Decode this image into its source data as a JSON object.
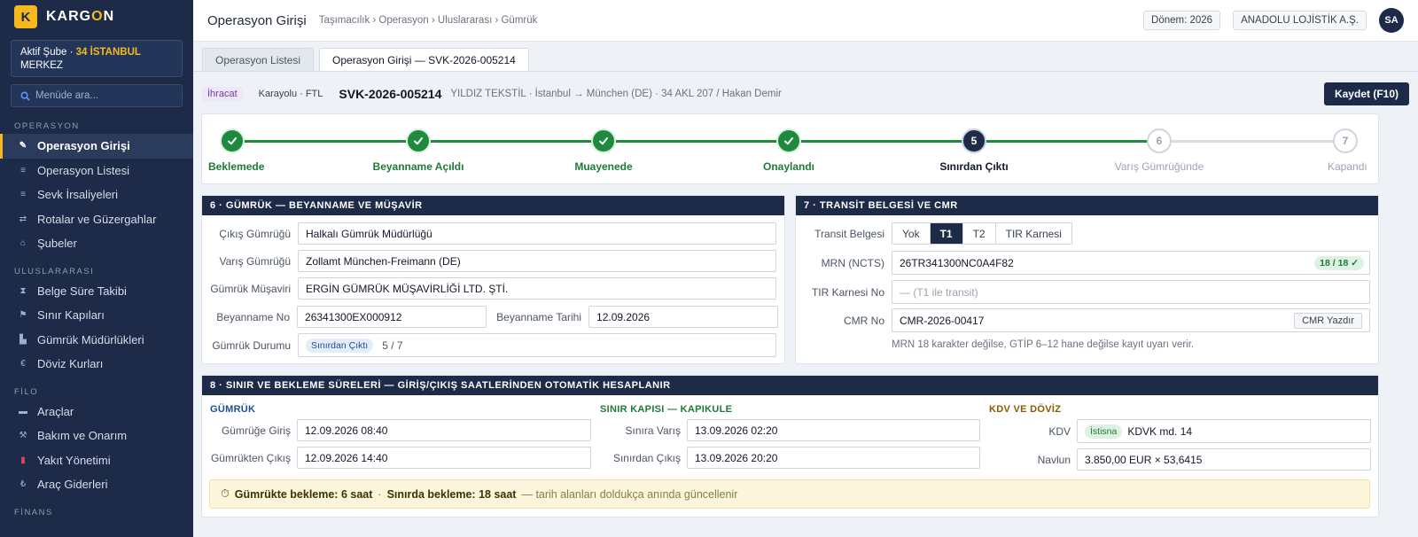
{
  "brand": {
    "logo": "K",
    "name_a": "KARG",
    "name_b": "O",
    "name_c": "N"
  },
  "branch": {
    "prefix": "Aktif Şube · ",
    "code": "34 İSTANBUL",
    "suffix": "MERKEZ"
  },
  "search": {
    "placeholder": "Menüde ara..."
  },
  "nav": {
    "sec_operasyon": "OPERASYON",
    "operasyon_girisi": "Operasyon Girişi",
    "operasyon_listesi": "Operasyon Listesi",
    "sevk": "Sevk İrsaliyeleri",
    "rotalar": "Rotalar ve Güzergahlar",
    "subeler": "Şubeler",
    "sec_uluslararasi": "ULUSLARARASI",
    "belge": "Belge Süre Takibi",
    "sinir": "Sınır Kapıları",
    "gumruk_mud": "Gümrük Müdürlükleri",
    "doviz": "Döviz Kurları",
    "sec_filo": "FİLO",
    "araclar": "Araçlar",
    "bakim": "Bakım ve Onarım",
    "yakit": "Yakıt Yönetimi",
    "arac_gider": "Araç Giderleri",
    "sec_finans": "FİNANS"
  },
  "header": {
    "title": "Operasyon Girişi",
    "breadcrumb": "Taşımacılık › Operasyon › Uluslararası › Gümrük",
    "period": "Dönem: 2026",
    "company": "ANADOLU LOJİSTİK A.Ş.",
    "avatar": "SA"
  },
  "tabs": {
    "list": "Operasyon Listesi",
    "entry": "Operasyon Girişi — SVK-2026-005214"
  },
  "op": {
    "type": "İhracat",
    "mode": "Karayolu · FTL",
    "number": "SVK-2026-005214",
    "desc": "YILDIZ TEKSTİL · İstanbul → München (DE) · 34 AKL 207 / Hakan Demir",
    "save": "Kaydet (F10)"
  },
  "steps": [
    {
      "num": "1",
      "label": "Beklemede",
      "state": "done"
    },
    {
      "num": "2",
      "label": "Beyanname Açıldı",
      "state": "done"
    },
    {
      "num": "3",
      "label": "Muayenede",
      "state": "done"
    },
    {
      "num": "4",
      "label": "Onaylandı",
      "state": "done"
    },
    {
      "num": "5",
      "label": "Sınırdan Çıktı",
      "state": "current"
    },
    {
      "num": "6",
      "label": "Varış Gümrüğünde",
      "state": "todo"
    },
    {
      "num": "7",
      "label": "Kapandı",
      "state": "todo"
    }
  ],
  "customs": {
    "title": "6 · GÜMRÜK  —  BEYANNAME VE MÜŞAVİR",
    "exit_label": "Çıkış Gümrüğü",
    "exit_value": "Halkalı Gümrük Müdürlüğü",
    "arr_label": "Varış Gümrüğü",
    "arr_value": "Zollamt München-Freimann (DE)",
    "broker_label": "Gümrük Müşaviri",
    "broker_value": "ERGİN GÜMRÜK MÜŞAVİRLİĞİ LTD. ŞTİ.",
    "decl_no_label": "Beyanname No",
    "decl_no_value": "26341300EX000912",
    "decl_date_label": "Beyanname Tarihi",
    "decl_date_value": "12.09.2026",
    "status_label": "Gümrük Durumu",
    "status_chip": "Sınırdan Çıktı",
    "status_step": "5 / 7"
  },
  "transit": {
    "title": "7 · TRANSİT BELGESİ VE CMR",
    "doc_label": "Transit Belgesi",
    "options": [
      "Yok",
      "T1",
      "T2",
      "TIR Karnesi"
    ],
    "selected": "T1",
    "mrn_label": "MRN (NCTS)",
    "mrn_value": "26TR341300NC0A4F82",
    "mrn_check": "18 / 18 ✓",
    "tir_label": "TIR Karnesi No",
    "tir_placeholder": "— (T1 ile transit)",
    "cmr_label": "CMR No",
    "cmr_value": "CMR-2026-00417",
    "cmr_print": "CMR Yazdır",
    "hint": "MRN 18 karakter değilse, GTİP 6–12 hane değilse kayıt uyarı verir."
  },
  "durations": {
    "title": "8 · SINIR VE BEKLEME SÜRELERİ  —  GİRİŞ/ÇIKIŞ SAATLERİNDEN OTOMATİK HESAPLANIR",
    "customs_head": "GÜMRÜK",
    "c_in_label": "Gümrüğe Giriş",
    "c_in_value": "12.09.2026 08:40",
    "c_out_label": "Gümrükten Çıkış",
    "c_out_value": "12.09.2026 14:40",
    "border_head": "SINIR KAPISI — KAPIKULE",
    "b_in_label": "Sınıra Varış",
    "b_in_value": "13.09.2026 02:20",
    "b_out_label": "Sınırdan Çıkış",
    "b_out_value": "13.09.2026 20:20",
    "vat_head": "KDV VE DÖVİZ",
    "kdv_label": "KDV",
    "kdv_chip": "İstisna",
    "kdv_value": "KDVK md. 14",
    "navlun_label": "Navlun",
    "navlun_value": "3.850,00 EUR × 53,6415",
    "wait_customs": "Gümrükte bekleme: 6 saat",
    "wait_border": "Sınırda bekleme: 18 saat",
    "wait_note": "— tarih alanları doldukça anında güncellenir"
  },
  "colors": {
    "navy": "#1d2b48",
    "accent": "#f5b91f",
    "done": "#1f8a3e",
    "border_head": "#1f7a37",
    "vat_head": "#8a5a00",
    "customs_head": "#1d4f91"
  }
}
